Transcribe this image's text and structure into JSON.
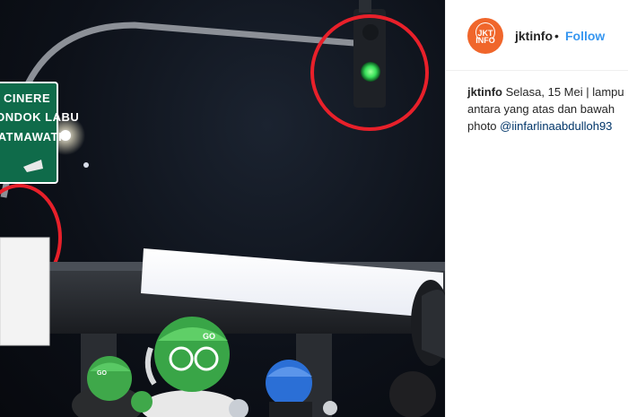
{
  "photo": {
    "sign": {
      "line1": "CINERE",
      "line2": "PONDOK LABU",
      "line3": "FATMAWATI"
    },
    "helmet_text": "GO"
  },
  "post": {
    "avatar_text": "JKT INFO",
    "username": "jktinfo",
    "separator": "•",
    "follow_label": "Follow",
    "caption": {
      "username": "jktinfo",
      "line1": "Selasa, 15 Mei | lampu",
      "line2": "antara yang atas dan bawah",
      "line3_prefix": "photo",
      "mention": "@iinfarlinaabdulloh93"
    }
  },
  "colors": {
    "accent": "#3897f0",
    "avatar_bg": "#f0662b",
    "highlight_circle": "#e8202a",
    "traffic_green": "#39e05a",
    "sign_green": "#0f6b4a"
  }
}
